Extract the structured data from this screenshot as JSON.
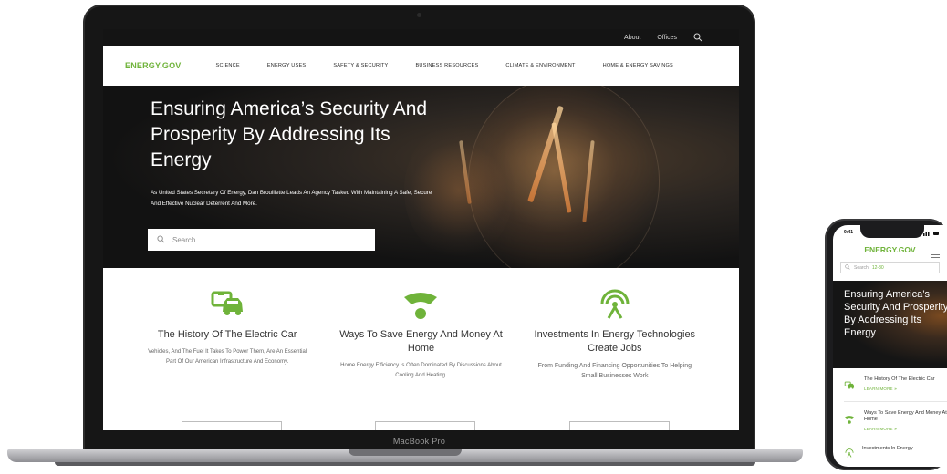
{
  "laptop": {
    "brand_label": "MacBook Pro",
    "utility_nav": {
      "about": "About",
      "offices": "Offices"
    },
    "site_logo": "ENERGY.GOV",
    "nav_items": [
      "SCIENCE",
      "ENERGY USES",
      "SAFETY & SECURITY",
      "BUSINESS RESOURCES",
      "CLIMATE & ENVIRONMENT",
      "HOME & ENERGY SAVINGS"
    ],
    "hero": {
      "title": "Ensuring America’s Security And Prosperity By Addressing Its Energy",
      "subtitle": "As United States Secretary Of Energy, Dan Brouillette Leads An Agency Tasked With Maintaining A Safe, Secure And Effective Nuclear Deterrent And More.",
      "search_placeholder": "Search"
    },
    "features": [
      {
        "icon": "electric-car-icon",
        "title": "The History Of The Electric Car",
        "text": "Vehicles, And The Fuel It Takes To Power Them, Are An Essential Part Of Our American Infrastructure And Economy."
      },
      {
        "icon": "wifi-signal-icon",
        "title": "Ways To Save Energy And Money At Home",
        "text": "Home Energy Efficiency Is Often Dominated By Discussions About Cooling And Heating."
      },
      {
        "icon": "broadcast-tower-icon",
        "title": "Investments In Energy Technologies Create Jobs",
        "text": "From Funding And Financing Opportunities To Helping Small Businesses Work"
      }
    ]
  },
  "phone": {
    "time": "9:41",
    "site_logo": "ENERGY.GOV",
    "search_placeholder": "Search",
    "search_hint": "12-30",
    "hero_title": "Ensuring America’s Security And Prosperity By Addressing Its Energy",
    "items": [
      {
        "icon": "electric-car-icon",
        "title": "The History Of The Electric Car",
        "link": "LEARN MORE"
      },
      {
        "icon": "wifi-signal-icon",
        "title": "Ways To Save Energy And Money At Home",
        "link": "LEARN MORE"
      }
    ],
    "last_item": {
      "icon": "broadcast-tower-icon",
      "title": "Investments In Energy"
    }
  },
  "colors": {
    "brand_green": "#6fb33a",
    "hero_dark": "#141414"
  }
}
